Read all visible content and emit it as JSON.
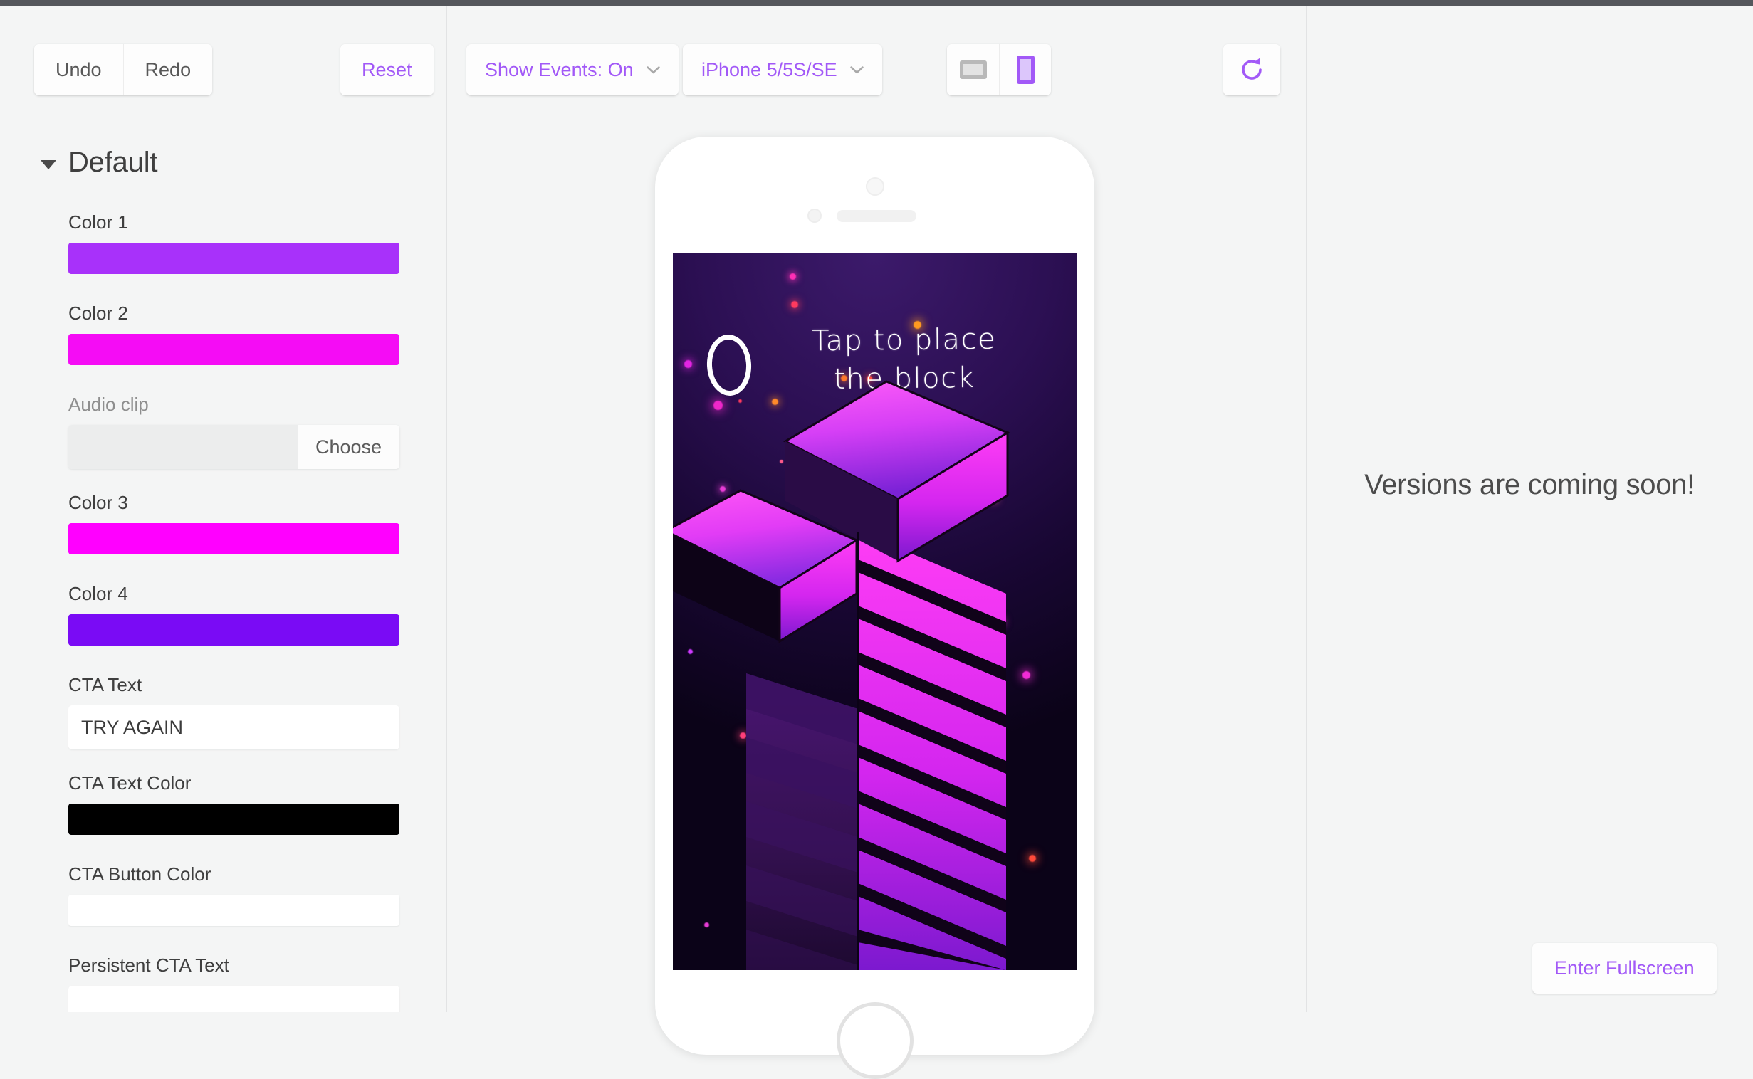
{
  "theme": {
    "accent": "#a259f7",
    "page_bg": "#f4f5f5",
    "panel_bg": "#fdfdfd",
    "divider": "#e2e3e4",
    "text": "#3f3f3f",
    "muted_text": "#8e8e8e"
  },
  "toolbar": {
    "undo_label": "Undo",
    "redo_label": "Redo",
    "reset_label": "Reset",
    "events_dropdown": {
      "value": "Show Events: On",
      "icon": "chevron-down-icon"
    },
    "device_dropdown": {
      "value": "iPhone 5/5S/SE",
      "icon": "chevron-down-icon"
    },
    "orientation": {
      "landscape_icon": "landscape-orientation-icon",
      "portrait_icon": "portrait-orientation-icon",
      "selected": "portrait"
    },
    "refresh_icon": "refresh-icon"
  },
  "sidebar": {
    "section": {
      "title": "Default",
      "expanded": true,
      "caret_icon": "caret-down-icon"
    },
    "fields": [
      {
        "label": "Color 1",
        "type": "color",
        "value": "#a831fa"
      },
      {
        "label": "Color 2",
        "type": "color",
        "value": "#f50cf5"
      },
      {
        "label": "Audio clip",
        "type": "file",
        "value": "",
        "choose_label": "Choose",
        "muted": true
      },
      {
        "label": "Color 3",
        "type": "color",
        "value": "#ff00ff"
      },
      {
        "label": "Color 4",
        "type": "color",
        "value": "#7a0bf5"
      },
      {
        "label": "CTA Text",
        "type": "text",
        "value": "TRY AGAIN",
        "placeholder": ""
      },
      {
        "label": "CTA Text Color",
        "type": "color",
        "value": "#000000"
      },
      {
        "label": "CTA Button Color",
        "type": "color",
        "value": "#ffffff"
      },
      {
        "label": "Persistent CTA Text",
        "type": "text",
        "value": ""
      }
    ]
  },
  "preview": {
    "device": "iPhone 5/5S/SE",
    "orientation": "portrait",
    "game": {
      "score": "0",
      "hint_text": "Tap to place the block",
      "background_top": "#3c1a6b",
      "background_bottom": "#0b0318",
      "block_light": "#ff3df5",
      "block_dark": "#6a17c9"
    }
  },
  "right_panel": {
    "message": "Versions are coming soon!",
    "fullscreen_label": "Enter Fullscreen"
  }
}
